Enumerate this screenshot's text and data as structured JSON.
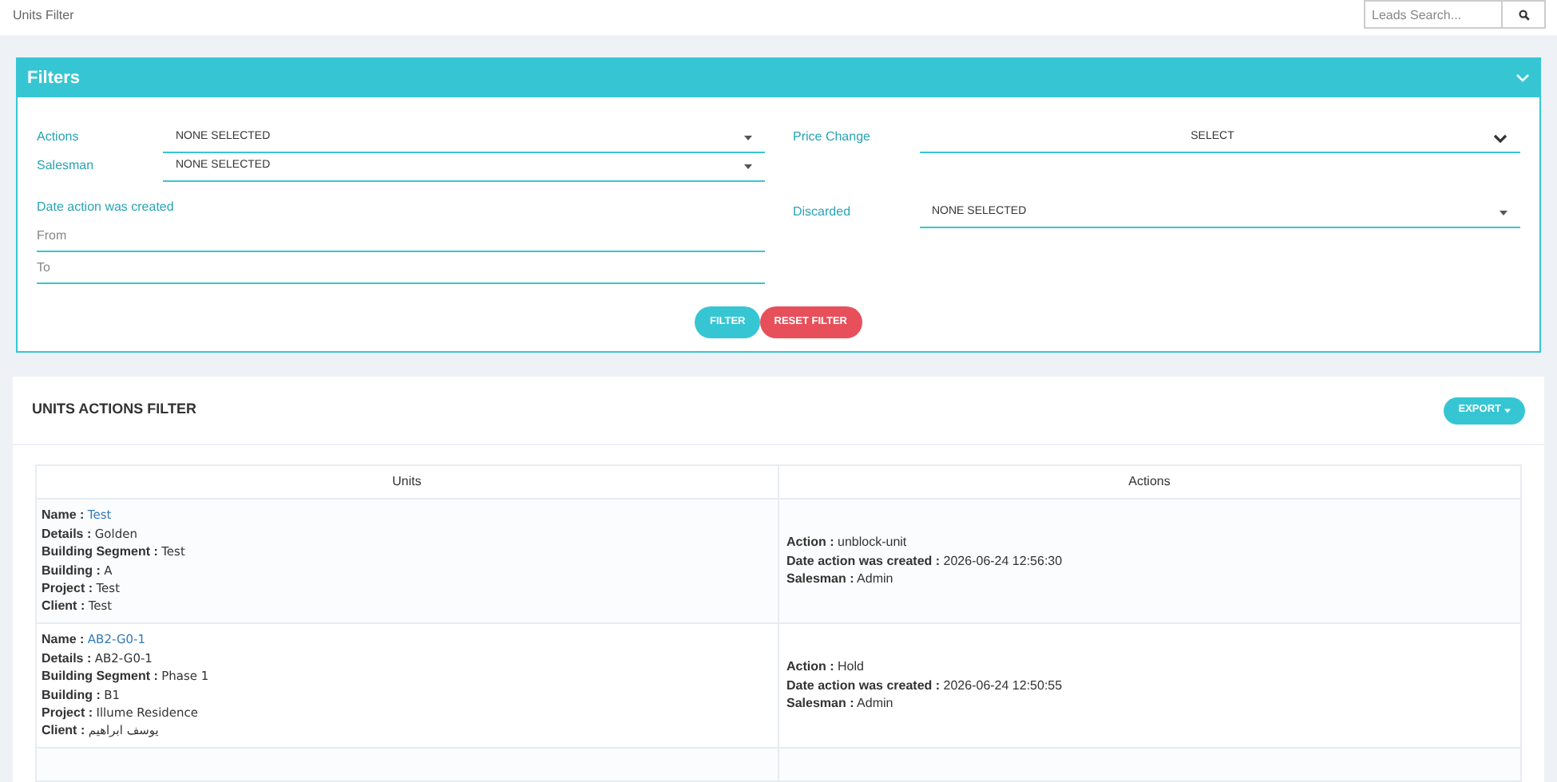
{
  "page_title": "Units Filter",
  "search": {
    "placeholder": "Leads Search..."
  },
  "filters": {
    "title": "Filters",
    "expanded": true,
    "left": [
      {
        "label": "Actions",
        "value": "NONE SELECTED"
      },
      {
        "label": "Salesman",
        "value": "NONE SELECTED"
      }
    ],
    "date": {
      "label": "Date action was created",
      "from_placeholder": "From",
      "to_placeholder": "To"
    },
    "price_change": {
      "label": "Price Change",
      "value": "SELECT"
    },
    "discarded": {
      "label": "Discarded",
      "value": "NONE SELECTED"
    },
    "buttons": [
      {
        "label": "FILTER",
        "kind": "primary"
      },
      {
        "label": "RESET FILTER",
        "kind": "danger"
      }
    ]
  },
  "results": {
    "title": "UNITS ACTIONS FILTER",
    "export": "EXPORT",
    "columns": [
      "Units",
      "Actions"
    ],
    "rows": [
      {
        "units": [
          {
            "label": "Name :",
            "value": "Test",
            "link": true
          },
          {
            "label": "Details :",
            "value": "Golden",
            "link": false
          },
          {
            "label": "Building Segment :",
            "value": "Test",
            "link": false
          },
          {
            "label": "Building :",
            "value": "A",
            "link": false
          },
          {
            "label": "Project :",
            "value": "Test",
            "link": false
          },
          {
            "label": "Client :",
            "value": "Test",
            "link": false
          }
        ],
        "actions": [
          {
            "label": "Action :",
            "value": "unblock-unit"
          },
          {
            "label": "Date action was created :",
            "value": "2026-06-24 12:56:30"
          },
          {
            "label": "Salesman :",
            "value": "Admin"
          }
        ]
      },
      {
        "units": [
          {
            "label": "Name :",
            "value": "AB2-G0-1",
            "link": true
          },
          {
            "label": "Details :",
            "value": "AB2-G0-1",
            "link": false
          },
          {
            "label": "Building Segment :",
            "value": "Phase 1",
            "link": false
          },
          {
            "label": "Building :",
            "value": "B1",
            "link": false
          },
          {
            "label": "Project :",
            "value": "Illume Residence",
            "link": false
          },
          {
            "label": "Client :",
            "value": "يوسف ابراهيم",
            "link": false
          }
        ],
        "actions": [
          {
            "label": "Action :",
            "value": "Hold"
          },
          {
            "label": "Date action was created :",
            "value": "2026-06-24 12:50:55"
          },
          {
            "label": "Salesman :",
            "value": "Admin"
          }
        ]
      }
    ]
  }
}
